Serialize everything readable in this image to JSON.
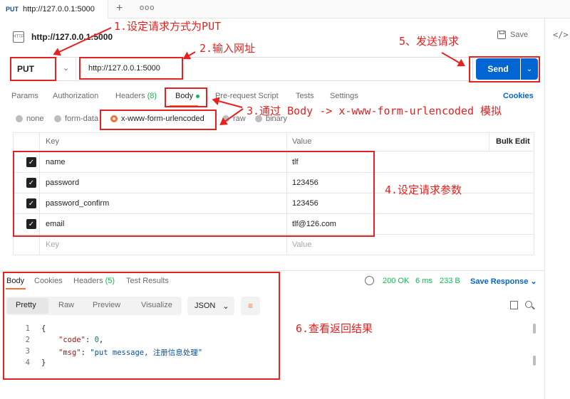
{
  "tab": {
    "method": "PUT",
    "url": "http://127.0.0.1:5000"
  },
  "header": {
    "title": "http://127.0.0.1:5000",
    "save_label": "Save",
    "http_icon_text": "HTTP"
  },
  "request": {
    "method": "PUT",
    "url": "http://127.0.0.1:5000",
    "send_label": "Send"
  },
  "req_tabs": {
    "params": "Params",
    "authorization": "Authorization",
    "headers": "Headers",
    "headers_count": "(8)",
    "body": "Body",
    "pre_request": "Pre-request Script",
    "tests": "Tests",
    "settings": "Settings",
    "cookies": "Cookies"
  },
  "body_modes": {
    "none": "none",
    "form_data": "form-data",
    "urlencoded": "x-www-form-urlencoded",
    "raw": "raw",
    "binary": "binary"
  },
  "params_table": {
    "col_key": "Key",
    "col_value": "Value",
    "bulk_edit": "Bulk Edit",
    "rows": [
      {
        "key": "name",
        "value": "tlf",
        "checked": true
      },
      {
        "key": "password",
        "value": "123456",
        "checked": true
      },
      {
        "key": "password_confirm",
        "value": "123456",
        "checked": true
      },
      {
        "key": "email",
        "value": "tlf@126.com",
        "checked": true
      }
    ],
    "placeholder_key": "Key",
    "placeholder_value": "Value"
  },
  "response": {
    "tabs": {
      "body": "Body",
      "cookies": "Cookies",
      "headers": "Headers",
      "headers_count": "(5)",
      "test_results": "Test Results"
    },
    "status": "200 OK",
    "time": "6 ms",
    "size": "233 B",
    "save_response": "Save Response",
    "views": {
      "pretty": "Pretty",
      "raw": "Raw",
      "preview": "Preview",
      "visualize": "Visualize"
    },
    "format": "JSON",
    "code_lines": [
      {
        "n": "1",
        "text": "{"
      },
      {
        "n": "2",
        "key": "\"code\"",
        "sep": ": ",
        "val": "0",
        "tail": ","
      },
      {
        "n": "3",
        "key": "\"msg\"",
        "sep": ": ",
        "val": "\"put message, 注册信息处理\""
      },
      {
        "n": "4",
        "text": "}"
      }
    ]
  },
  "annotations": {
    "a1": "1.设定请求方式为PUT",
    "a2": "2.输入网址",
    "a3": "3.通过 Body -> x-www-form-urlencoded 模拟",
    "a4": "4.设定请求参数",
    "a5": "5、发送请求",
    "a6": "6.查看返回结果"
  },
  "colors": {
    "accent": "#ff6c37",
    "send": "#0265d2",
    "annotation": "#e8201f",
    "status_ok": "#0cbb52"
  }
}
